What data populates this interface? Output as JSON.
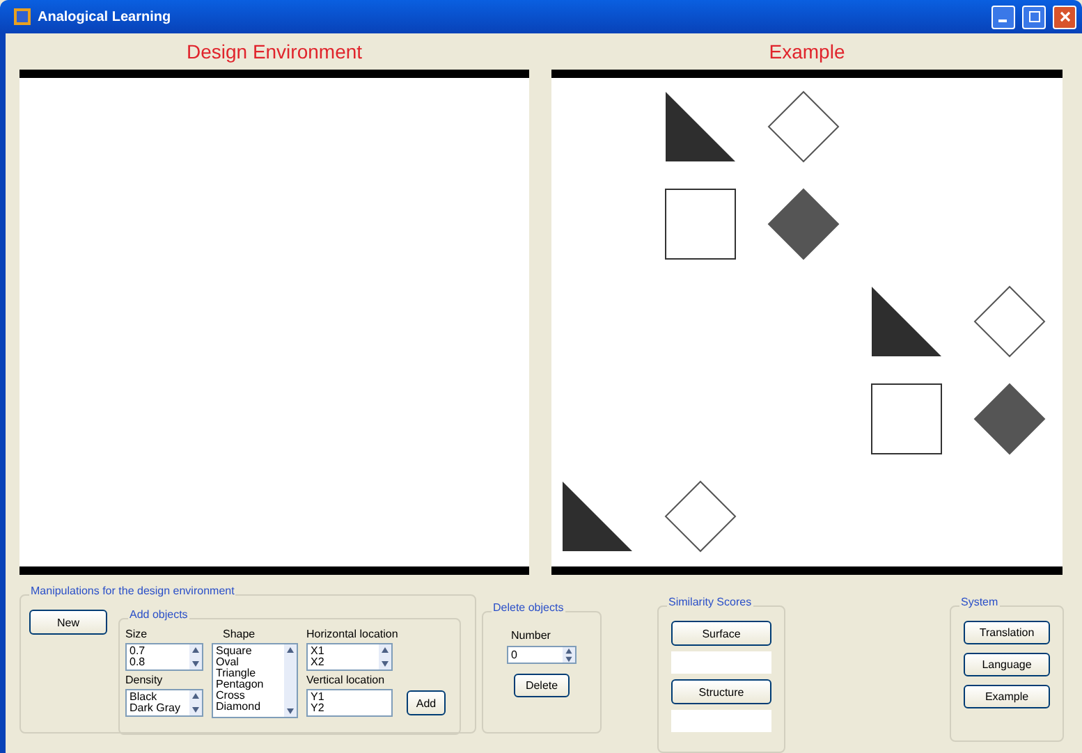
{
  "window": {
    "title": "Analogical Learning"
  },
  "design": {
    "title": "Design Environment"
  },
  "example": {
    "title": "Example",
    "grid": [
      {
        "cells": [
          {
            "kind": "empty"
          },
          {
            "kind": "triangle",
            "color": "#2e2e2e"
          },
          {
            "kind": "diamond",
            "color": "#ffffff"
          },
          {
            "kind": "empty"
          },
          {
            "kind": "empty"
          }
        ]
      },
      {
        "cells": [
          {
            "kind": "empty"
          },
          {
            "kind": "square",
            "color": "#ffffff"
          },
          {
            "kind": "diamond",
            "color": "#555555"
          },
          {
            "kind": "empty"
          },
          {
            "kind": "empty"
          }
        ]
      },
      {
        "cells": [
          {
            "kind": "empty"
          },
          {
            "kind": "empty"
          },
          {
            "kind": "empty"
          },
          {
            "kind": "triangle",
            "color": "#2e2e2e"
          },
          {
            "kind": "diamond",
            "color": "#ffffff"
          }
        ]
      },
      {
        "cells": [
          {
            "kind": "empty"
          },
          {
            "kind": "empty"
          },
          {
            "kind": "empty"
          },
          {
            "kind": "square",
            "color": "#ffffff"
          },
          {
            "kind": "diamond",
            "color": "#555555"
          }
        ]
      },
      {
        "cells": [
          {
            "kind": "triangle",
            "color": "#2e2e2e"
          },
          {
            "kind": "diamond",
            "color": "#ffffff"
          },
          {
            "kind": "empty"
          },
          {
            "kind": "empty"
          },
          {
            "kind": "empty"
          }
        ]
      }
    ]
  },
  "manipulations": {
    "title": "Manipulations for the design environment",
    "new_button": "New",
    "add_objects": {
      "title": "Add objects",
      "size": {
        "label": "Size",
        "items": [
          "0.7",
          "0.8"
        ]
      },
      "density": {
        "label": "Density",
        "items": [
          "Black",
          "Dark Gray"
        ]
      },
      "shape": {
        "label": "Shape",
        "items": [
          "Square",
          "Oval",
          "Triangle",
          "Pentagon",
          "Cross",
          "Diamond"
        ]
      },
      "horizontal": {
        "label": "Horizontal location",
        "items": [
          "X1",
          "X2"
        ]
      },
      "vertical": {
        "label": "Vertical location",
        "value": "Y1\nY2"
      },
      "add_button": "Add"
    }
  },
  "delete_objects": {
    "title": "Delete objects",
    "number_label": "Number",
    "number_value": "0",
    "delete_button": "Delete"
  },
  "similarity": {
    "title": "Similarity Scores",
    "buttons": [
      "Surface",
      "Structure"
    ]
  },
  "system": {
    "title": "System",
    "buttons": [
      "Translation",
      "Language",
      "Example"
    ]
  }
}
